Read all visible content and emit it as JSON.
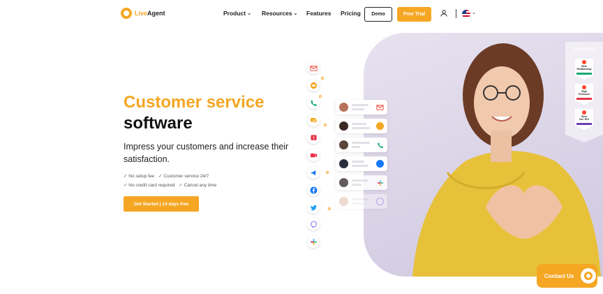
{
  "brand": {
    "name_part1": "Live",
    "name_part2": "Agent"
  },
  "nav": {
    "items": [
      {
        "label": "Product",
        "has_dropdown": true
      },
      {
        "label": "Resources",
        "has_dropdown": true
      },
      {
        "label": "Features",
        "has_dropdown": false
      },
      {
        "label": "Pricing",
        "has_dropdown": false
      }
    ],
    "demo_label": "Demo",
    "trial_label": "Free Trial",
    "user_icon": "user-icon",
    "language_icon": "us-flag-icon"
  },
  "hero": {
    "title_line1": "Customer service",
    "title_line2": "software",
    "subtitle": "Impress your customers and increase their satisfaction.",
    "checks_row1": [
      "✓ No setup fee",
      "✓ Customer service 24/7"
    ],
    "checks_row2": [
      "✓ No credit card required",
      "✓ Cancel any time"
    ],
    "cta_label": "Get Started | 14 days free"
  },
  "channels": [
    "gmail-icon",
    "chat-icon",
    "phone-icon",
    "message-icon",
    "forms-icon",
    "video-icon",
    "slack-icon",
    "facebook-icon",
    "twitter-icon",
    "viber-icon",
    "slack-icon"
  ],
  "tickets": [
    {
      "channel": "gmail-icon"
    },
    {
      "channel": "chat-icon"
    },
    {
      "channel": "phone-icon"
    },
    {
      "channel": "facebook-icon"
    },
    {
      "channel": "slack-icon"
    },
    {
      "channel": "viber-icon"
    }
  ],
  "awards": {
    "title": "Awards",
    "badges": [
      {
        "line1": "Best",
        "line2": "Relationship"
      },
      {
        "line1": "High",
        "line2": "Performer"
      },
      {
        "line1": "Best",
        "line2": "Est. ROI"
      }
    ]
  },
  "contact": {
    "label": "Contact Us"
  },
  "colors": {
    "accent": "#f5a623",
    "text": "#222222"
  }
}
